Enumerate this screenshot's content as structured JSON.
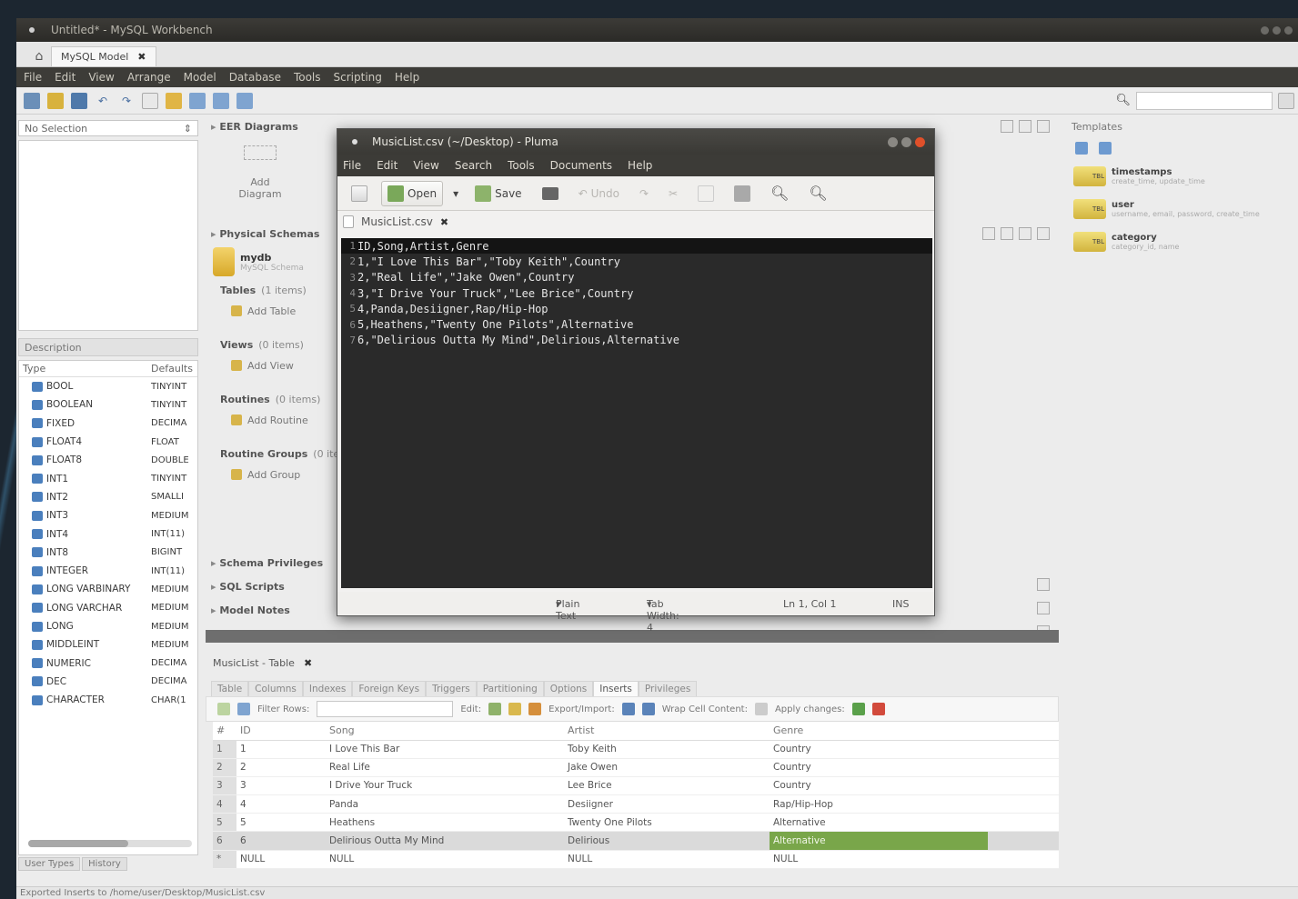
{
  "workbench": {
    "title": "Untitled* - MySQL Workbench",
    "tab_label": "MySQL Model",
    "menu": [
      "File",
      "Edit",
      "View",
      "Arrange",
      "Model",
      "Database",
      "Tools",
      "Scripting",
      "Help"
    ],
    "left": {
      "selector": "No Selection",
      "description_tab": "Description",
      "types_header": [
        "Type",
        "Defaults"
      ],
      "types": [
        {
          "name": "BOOL",
          "def": "TINYINT"
        },
        {
          "name": "BOOLEAN",
          "def": "TINYINT"
        },
        {
          "name": "FIXED",
          "def": "DECIMA"
        },
        {
          "name": "FLOAT4",
          "def": "FLOAT"
        },
        {
          "name": "FLOAT8",
          "def": "DOUBLE"
        },
        {
          "name": "INT1",
          "def": "TINYINT"
        },
        {
          "name": "INT2",
          "def": "SMALLI"
        },
        {
          "name": "INT3",
          "def": "MEDIUM"
        },
        {
          "name": "INT4",
          "def": "INT(11)"
        },
        {
          "name": "INT8",
          "def": "BIGINT"
        },
        {
          "name": "INTEGER",
          "def": "INT(11)"
        },
        {
          "name": "LONG VARBINARY",
          "def": "MEDIUM"
        },
        {
          "name": "LONG VARCHAR",
          "def": "MEDIUM"
        },
        {
          "name": "LONG",
          "def": "MEDIUM"
        },
        {
          "name": "MIDDLEINT",
          "def": "MEDIUM"
        },
        {
          "name": "NUMERIC",
          "def": "DECIMA"
        },
        {
          "name": "DEC",
          "def": "DECIMA"
        },
        {
          "name": "CHARACTER",
          "def": "CHAR(1"
        }
      ],
      "bottom_tabs": [
        "User Types",
        "History"
      ]
    },
    "center": {
      "eer_section": "EER Diagrams",
      "add_diagram": "Add Diagram",
      "physical_section": "Physical Schemas",
      "schema_name": "mydb",
      "schema_sub": "MySQL Schema",
      "tables_label": "Tables",
      "tables_count": "(1 items)",
      "add_table": "Add Table",
      "views_label": "Views",
      "views_count": "(0 items)",
      "add_view": "Add View",
      "routines_label": "Routines",
      "routines_count": "(0 items)",
      "add_routine": "Add Routine",
      "routine_groups_label": "Routine Groups",
      "routine_groups_count": "(0 items)",
      "add_group": "Add Group",
      "schema_privileges": "Schema Privileges",
      "sql_scripts": "SQL Scripts",
      "model_notes": "Model Notes"
    },
    "editor": {
      "tab_label": "MusicList - Table",
      "subtabs": [
        "Table",
        "Columns",
        "Indexes",
        "Foreign Keys",
        "Triggers",
        "Partitioning",
        "Options",
        "Inserts",
        "Privileges"
      ],
      "active_subtab": "Inserts",
      "filter_label": "Filter Rows:",
      "edit_label": "Edit:",
      "export_label": "Export/Import:",
      "wrap_label": "Wrap Cell Content:",
      "apply_label": "Apply changes:",
      "columns": [
        "#",
        "ID",
        "Song",
        "Artist",
        "Genre"
      ],
      "rows": [
        {
          "n": "1",
          "id": "1",
          "song": "I Love This Bar",
          "artist": "Toby Keith",
          "genre": "Country"
        },
        {
          "n": "2",
          "id": "2",
          "song": "Real Life",
          "artist": "Jake Owen",
          "genre": "Country"
        },
        {
          "n": "3",
          "id": "3",
          "song": "I Drive Your Truck",
          "artist": "Lee Brice",
          "genre": "Country"
        },
        {
          "n": "4",
          "id": "4",
          "song": "Panda",
          "artist": "Desiigner",
          "genre": "Rap/Hip-Hop"
        },
        {
          "n": "5",
          "id": "5",
          "song": "Heathens",
          "artist": "Twenty One Pilots",
          "genre": "Alternative"
        },
        {
          "n": "6",
          "id": "6",
          "song": "Delirious Outta My Mind",
          "artist": "Delirious",
          "genre": "Alternative"
        },
        {
          "n": "*",
          "id": "NULL",
          "song": "NULL",
          "artist": "NULL",
          "genre": "NULL"
        }
      ]
    },
    "right": {
      "title": "Templates",
      "items": [
        {
          "name": "timestamps",
          "desc": "create_time, update_time",
          "icon": "TBL"
        },
        {
          "name": "user",
          "desc": "username, email, password, create_time",
          "icon": "TBL"
        },
        {
          "name": "category",
          "desc": "category_id, name",
          "icon": "TBL"
        }
      ]
    },
    "status": "Exported Inserts to /home/user/Desktop/MusicList.csv"
  },
  "pluma": {
    "title": "MusicList.csv (~/Desktop) - Pluma",
    "menu": [
      "File",
      "Edit",
      "View",
      "Search",
      "Tools",
      "Documents",
      "Help"
    ],
    "open_label": "Open",
    "save_label": "Save",
    "undo_label": "Undo",
    "tab_label": "MusicList.csv",
    "lines": [
      "ID,Song,Artist,Genre",
      "1,\"I Love This Bar\",\"Toby Keith\",Country",
      "2,\"Real Life\",\"Jake Owen\",Country",
      "3,\"I Drive Your Truck\",\"Lee Brice\",Country",
      "4,Panda,Desiigner,Rap/Hip-Hop",
      "5,Heathens,\"Twenty One Pilots\",Alternative",
      "6,\"Delirious Outta My Mind\",Delirious,Alternative"
    ],
    "status": {
      "language": "Plain Text",
      "tab_width": "Tab Width: 4",
      "position": "Ln 1, Col 1",
      "mode": "INS"
    }
  },
  "colors": {
    "accent_green": "#79a64a",
    "close_orange": "#e0502a"
  }
}
